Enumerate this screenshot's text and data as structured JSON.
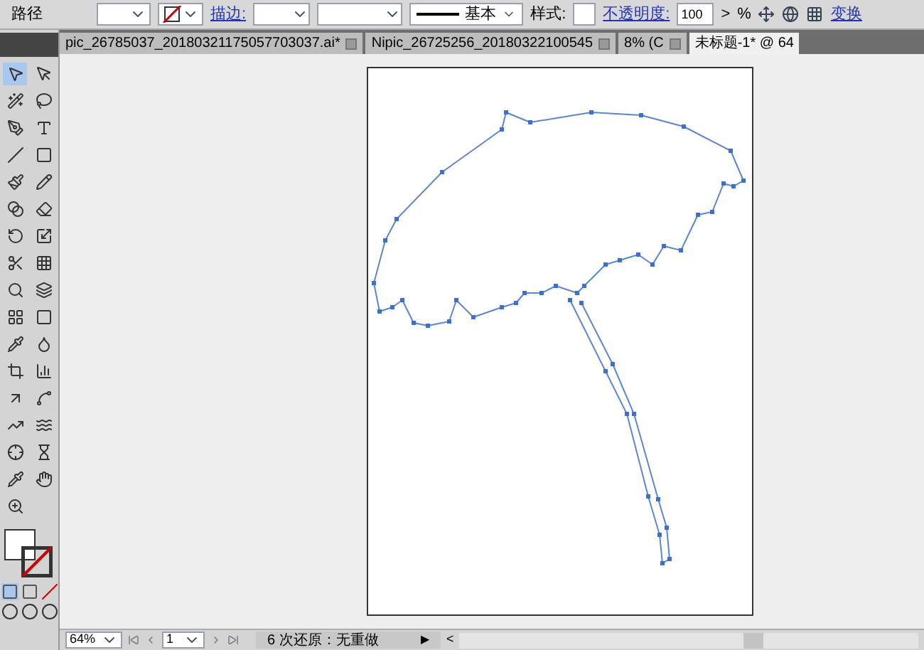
{
  "control_bar": {
    "object_type": "路径",
    "stroke_label": "描边:",
    "brush_label": "基本",
    "style_label": "样式:",
    "opacity_label": "不透明度:",
    "opacity_value": "100",
    "opacity_arrow": ">",
    "percent": "%",
    "transform_link": "变换"
  },
  "tabs": [
    {
      "label": "pic_26785037_20180321175057703037.ai*",
      "selected": false
    },
    {
      "label": "Nipic_26725256_20180322100545",
      "selected": false
    },
    {
      "label": "8% (C",
      "selected": false
    },
    {
      "label": "未标题-1* @ 64",
      "selected": true
    }
  ],
  "toolbox": {
    "tools": [
      {
        "selected": true
      },
      {
        "selected": false
      },
      {
        "selected": false
      },
      {
        "selected": false
      },
      {
        "selected": false
      },
      {
        "selected": false
      },
      {
        "selected": false
      },
      {
        "selected": false
      },
      {
        "selected": false
      },
      {
        "selected": false
      },
      {
        "selected": false
      },
      {
        "selected": false
      },
      {
        "selected": false
      },
      {
        "selected": false
      },
      {
        "selected": false
      },
      {
        "selected": false
      },
      {
        "selected": false
      },
      {
        "selected": false
      },
      {
        "selected": false
      },
      {
        "selected": false
      },
      {
        "selected": false
      },
      {
        "selected": false
      },
      {
        "selected": false
      },
      {
        "selected": false
      },
      {
        "selected": false
      },
      {
        "selected": false
      },
      {
        "selected": false
      },
      {
        "selected": false
      },
      {
        "selected": false
      },
      {
        "selected": false
      },
      {
        "selected": false
      },
      {
        "selected": false
      },
      {
        "selected": false
      }
    ]
  },
  "status_bar": {
    "zoom": "64%",
    "page": "1",
    "history": "6 次还原：无重做",
    "play": "▶",
    "scroll_left": "<"
  }
}
